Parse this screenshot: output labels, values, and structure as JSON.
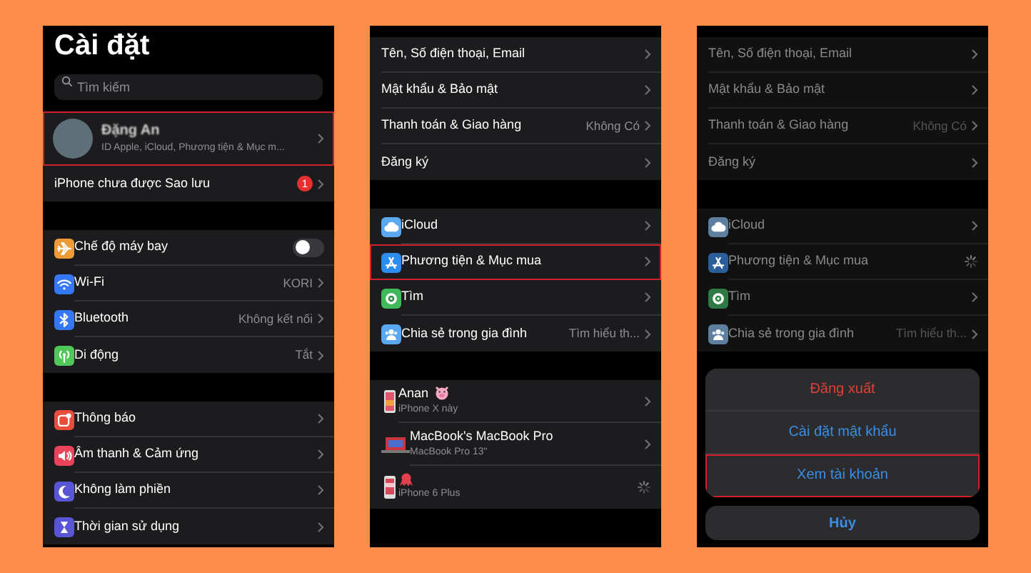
{
  "panels": [
    {
      "kind": "settings",
      "dimmed": false,
      "title": "Cài đặt",
      "search": {
        "placeholder": "Tìm kiếm"
      },
      "profile": {
        "name": "Đặng An",
        "subtitle": "ID Apple, iCloud, Phương tiện & Mục m...",
        "highlighted": true
      },
      "sections": [
        {
          "kind": "backup",
          "rows": [
            {
              "kind": "badge",
              "label": "iPhone chưa được Sao lưu",
              "badge": "1",
              "highlighted": false
            }
          ]
        },
        {
          "kind": "network",
          "rows": [
            {
              "kind": "toggle",
              "label": "Chế độ máy bay",
              "on": false,
              "color": "#f09a37",
              "highlighted": false
            },
            {
              "kind": "nav",
              "label": "Wi-Fi",
              "value": "KORI",
              "color": "#3478f6",
              "highlighted": false
            },
            {
              "kind": "nav",
              "label": "Bluetooth",
              "value": "Không kết nối",
              "color": "#3478f6",
              "highlighted": false
            },
            {
              "kind": "nav",
              "label": "Di động",
              "value": "Tắt",
              "color": "#4fc759",
              "highlighted": false
            }
          ]
        },
        {
          "kind": "alerts",
          "rows": [
            {
              "kind": "nav",
              "label": "Thông báo",
              "color": "#eb4d3d",
              "highlighted": false
            },
            {
              "kind": "nav",
              "label": "Âm thanh & Cảm ứng",
              "color": "#eb445a",
              "highlighted": false
            },
            {
              "kind": "nav",
              "label": "Không làm phiền",
              "color": "#5856d6",
              "highlighted": false
            },
            {
              "kind": "nav",
              "label": "Thời gian sử dụng",
              "color": "#5856d6",
              "highlighted": false
            }
          ]
        }
      ]
    },
    {
      "kind": "apple_id",
      "dimmed": false,
      "sections": [
        {
          "kind": "account",
          "rows": [
            {
              "kind": "nav",
              "label": "Tên, Số điện thoại, Email",
              "highlighted": false
            },
            {
              "kind": "nav",
              "label": "Mật khẩu & Bảo mật",
              "highlighted": false
            },
            {
              "kind": "nav",
              "label": "Thanh toán & Giao hàng",
              "value": "Không Có",
              "highlighted": false
            },
            {
              "kind": "nav",
              "label": "Đăng ký",
              "highlighted": false
            }
          ]
        },
        {
          "kind": "services",
          "rows": [
            {
              "kind": "nav",
              "label": "iCloud",
              "color": "#5aa9f0",
              "highlighted": false
            },
            {
              "kind": "nav",
              "label": "Phương tiện & Mục mua",
              "color": "#2d8cf0",
              "highlighted": true
            },
            {
              "kind": "nav",
              "label": "Tìm",
              "color": "#40b95a",
              "highlighted": false
            },
            {
              "kind": "nav",
              "label": "Chia sẻ trong gia đình",
              "value": "Tìm hiểu th...",
              "color": "#5aa9f0",
              "highlighted": false
            }
          ]
        },
        {
          "kind": "devices",
          "rows": [
            {
              "kind": "nav",
              "label": "Anan",
              "subtitle": "iPhone X này",
              "highlighted": false
            },
            {
              "kind": "nav",
              "label": "MacBook's MacBook Pro",
              "subtitle": "MacBook Pro 13\"",
              "highlighted": false
            },
            {
              "kind": "loading",
              "subtitle": "iPhone 6 Plus",
              "highlighted": false
            }
          ]
        }
      ]
    },
    {
      "kind": "apple_id",
      "dimmed": true,
      "sections": [
        {
          "kind": "account",
          "rows": [
            {
              "kind": "nav",
              "label": "Tên, Số điện thoại, Email",
              "highlighted": false
            },
            {
              "kind": "nav",
              "label": "Mật khẩu & Bảo mật",
              "highlighted": false
            },
            {
              "kind": "nav",
              "label": "Thanh toán & Giao hàng",
              "value": "Không Có",
              "highlighted": false
            },
            {
              "kind": "nav",
              "label": "Đăng ký",
              "highlighted": false
            }
          ]
        },
        {
          "kind": "services",
          "rows": [
            {
              "kind": "nav",
              "label": "iCloud",
              "color": "#5f7f9e",
              "highlighted": false
            },
            {
              "kind": "loading",
              "label": "Phương tiện & Mục mua",
              "color": "#2a5f99",
              "highlighted": false
            },
            {
              "kind": "nav",
              "label": "Tìm",
              "color": "#2f7a44",
              "highlighted": false
            },
            {
              "kind": "nav",
              "label": "Chia sẻ trong gia đình",
              "value": "Tìm hiểu th...",
              "color": "#5f7f9e",
              "highlighted": false
            }
          ]
        }
      ],
      "action_sheet": [
        {
          "kind": "destructive",
          "label": "Đăng xuất",
          "highlighted": false
        },
        {
          "kind": "default",
          "label": "Cài đặt mật khẩu",
          "highlighted": false
        },
        {
          "kind": "default",
          "label": "Xem tài khoản",
          "highlighted": true
        },
        {
          "kind": "cancel",
          "label": "Hủy",
          "highlighted": false
        }
      ]
    }
  ]
}
